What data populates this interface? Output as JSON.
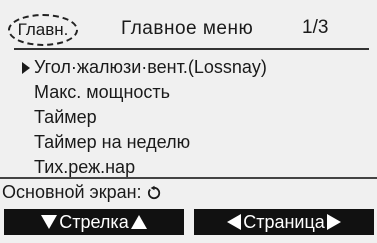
{
  "header": {
    "home_label": "Главн.",
    "title": "Главное меню",
    "page_indicator": "1/3"
  },
  "menu": {
    "items": [
      {
        "label": "Угол·жалюзи·вент.(Lossnay)",
        "selected": true
      },
      {
        "label": "Макс. мощность",
        "selected": false
      },
      {
        "label": "Таймер",
        "selected": false
      },
      {
        "label": "Таймер на неделю",
        "selected": false
      },
      {
        "label": "Тих.реж.нар",
        "selected": false
      }
    ]
  },
  "footer": {
    "home_screen_label": "Основной экран:",
    "return_icon": "return-arrow-icon"
  },
  "softkeys": {
    "cursor_label": "Стрелка",
    "page_label": "Страница"
  }
}
